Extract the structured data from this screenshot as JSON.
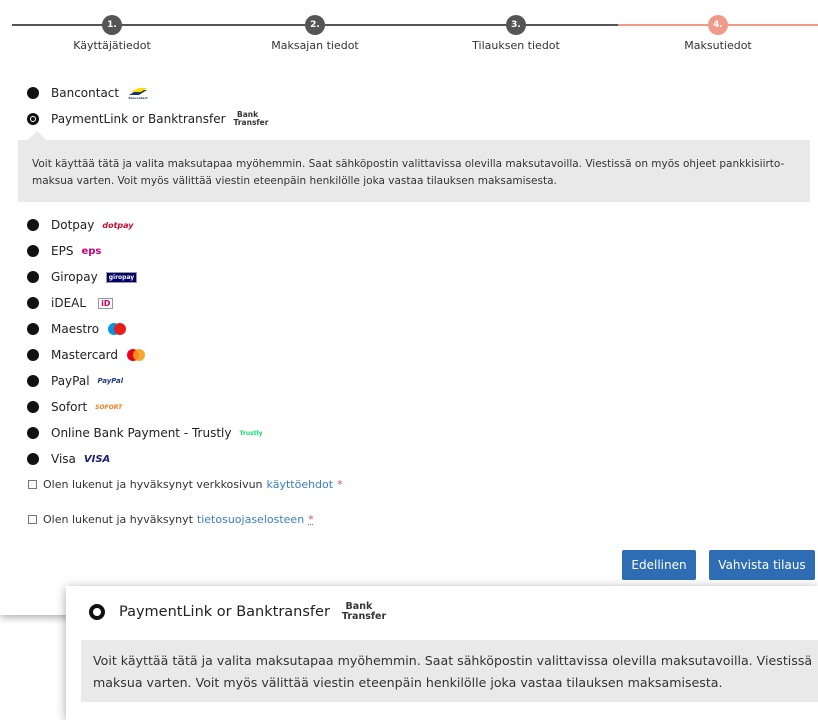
{
  "stepper": {
    "steps": [
      {
        "number": "1.",
        "label": "Käyttäjätiedot"
      },
      {
        "number": "2.",
        "label": "Maksajan tiedot"
      },
      {
        "number": "3.",
        "label": "Tilauksen tiedot"
      },
      {
        "number": "4.",
        "label": "Maksutiedot"
      }
    ]
  },
  "methods": [
    {
      "label": "Bancontact",
      "logo": "Bancontact"
    },
    {
      "label": "PaymentLink or Banktransfer",
      "logo": "Bank Transfer",
      "selected": true
    },
    {
      "label": "Dotpay",
      "logo": "dotpay"
    },
    {
      "label": "EPS",
      "logo": "eps"
    },
    {
      "label": "Giropay",
      "logo": "giropay"
    },
    {
      "label": "iDEAL",
      "logo": "iD"
    },
    {
      "label": "Maestro",
      "logo": "maestro"
    },
    {
      "label": "Mastercard",
      "logo": "mastercard"
    },
    {
      "label": "PayPal",
      "logo": "PayPal"
    },
    {
      "label": "Sofort",
      "logo": "SOFORT"
    },
    {
      "label": "Online Bank Payment - Trustly",
      "logo": "Trustly"
    },
    {
      "label": "Visa",
      "logo": "VISA"
    }
  ],
  "info_text_line1": "Voit käyttää tätä ja valita maksutapaa myöhemmin. Saat sähköpostin valittavissa olevilla maksutavoilla. Viestissä on myös ohjeet pankkisiirto-",
  "info_text_line2": "maksua varten. Voit myös välittää viestin eteenpäin henkilölle joka vastaa tilauksen maksamisesta.",
  "terms": {
    "text": "Olen lukenut ja hyväksynyt verkkosivun",
    "link": "käyttöehdot",
    "required": "*"
  },
  "privacy": {
    "text": "Olen lukenut ja hyväksynyt",
    "link": "tietosuojaselosteen",
    "required": "*"
  },
  "buttons": {
    "previous": "Edellinen",
    "confirm": "Vahvista tilaus"
  },
  "zoom": {
    "method_label": "PaymentLink or Banktransfer",
    "logo": "Bank Transfer",
    "line1": "Voit käyttää tätä ja valita maksutapaa myöhemmin. Saat sähköpostin valittavissa olevilla maksutavoilla. Viestissä",
    "line2": "maksua varten. Voit myös välittää viestin eteenpäin henkilölle joka vastaa tilauksen maksamisesta."
  },
  "colors": {
    "accent": "#2e6db4",
    "step_active": "#f09a8a",
    "step_done": "#555555",
    "link": "#3a7ec4"
  }
}
